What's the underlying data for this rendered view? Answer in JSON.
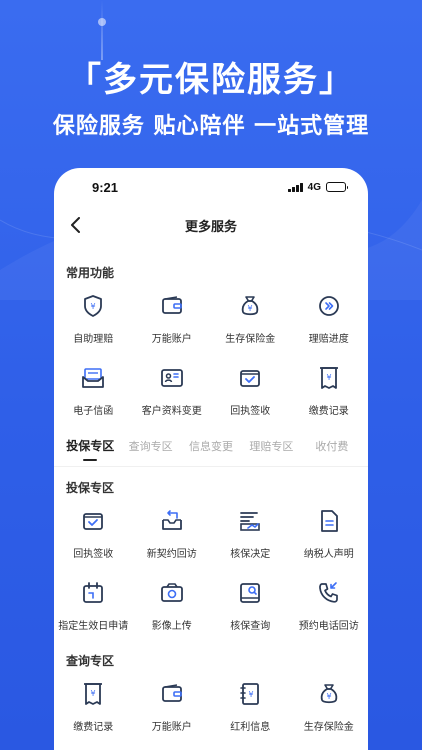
{
  "hero": {
    "headline": "「多元保险服务」",
    "subline": "保险服务  贴心陪伴  一站式管理"
  },
  "status_bar": {
    "time": "9:21",
    "network": "4G"
  },
  "nav": {
    "title": "更多服务"
  },
  "common": {
    "title": "常用功能",
    "items": [
      {
        "label": "自助理赔",
        "icon": "shield-yen-icon"
      },
      {
        "label": "万能账户",
        "icon": "wallet-icon"
      },
      {
        "label": "生存保险金",
        "icon": "money-bag-icon"
      },
      {
        "label": "理赔进度",
        "icon": "progress-circle-icon"
      },
      {
        "label": "电子信函",
        "icon": "mail-icon"
      },
      {
        "label": "客户资料变更",
        "icon": "id-card-icon"
      },
      {
        "label": "回执签收",
        "icon": "receipt-check-icon"
      },
      {
        "label": "缴费记录",
        "icon": "payment-record-icon"
      }
    ]
  },
  "tabs": [
    {
      "label": "投保专区",
      "active": true
    },
    {
      "label": "查询专区",
      "active": false
    },
    {
      "label": "信息变更",
      "active": false
    },
    {
      "label": "理赔专区",
      "active": false
    },
    {
      "label": "收付费",
      "active": false
    }
  ],
  "insure_zone": {
    "title": "投保专区",
    "items": [
      {
        "label": "回执签收",
        "icon": "receipt-check-icon"
      },
      {
        "label": "新契约回访",
        "icon": "return-visit-icon"
      },
      {
        "label": "核保决定",
        "icon": "underwriting-icon"
      },
      {
        "label": "纳税人声明",
        "icon": "document-icon"
      },
      {
        "label": "指定生效日申请",
        "icon": "calendar-icon"
      },
      {
        "label": "影像上传",
        "icon": "camera-icon"
      },
      {
        "label": "核保查询",
        "icon": "search-doc-icon"
      },
      {
        "label": "预约电话回访",
        "icon": "phone-callback-icon"
      }
    ]
  },
  "query_zone": {
    "title": "查询专区",
    "items": [
      {
        "label": "缴费记录",
        "icon": "payment-record-icon"
      },
      {
        "label": "万能账户",
        "icon": "wallet-icon"
      },
      {
        "label": "红利信息",
        "icon": "bonus-book-icon"
      },
      {
        "label": "生存保险金",
        "icon": "money-bag-icon"
      }
    ]
  },
  "colors": {
    "brand_blue": "#2f5fe8",
    "icon_dark": "#2b3a55",
    "icon_accent": "#3d6ef5"
  }
}
